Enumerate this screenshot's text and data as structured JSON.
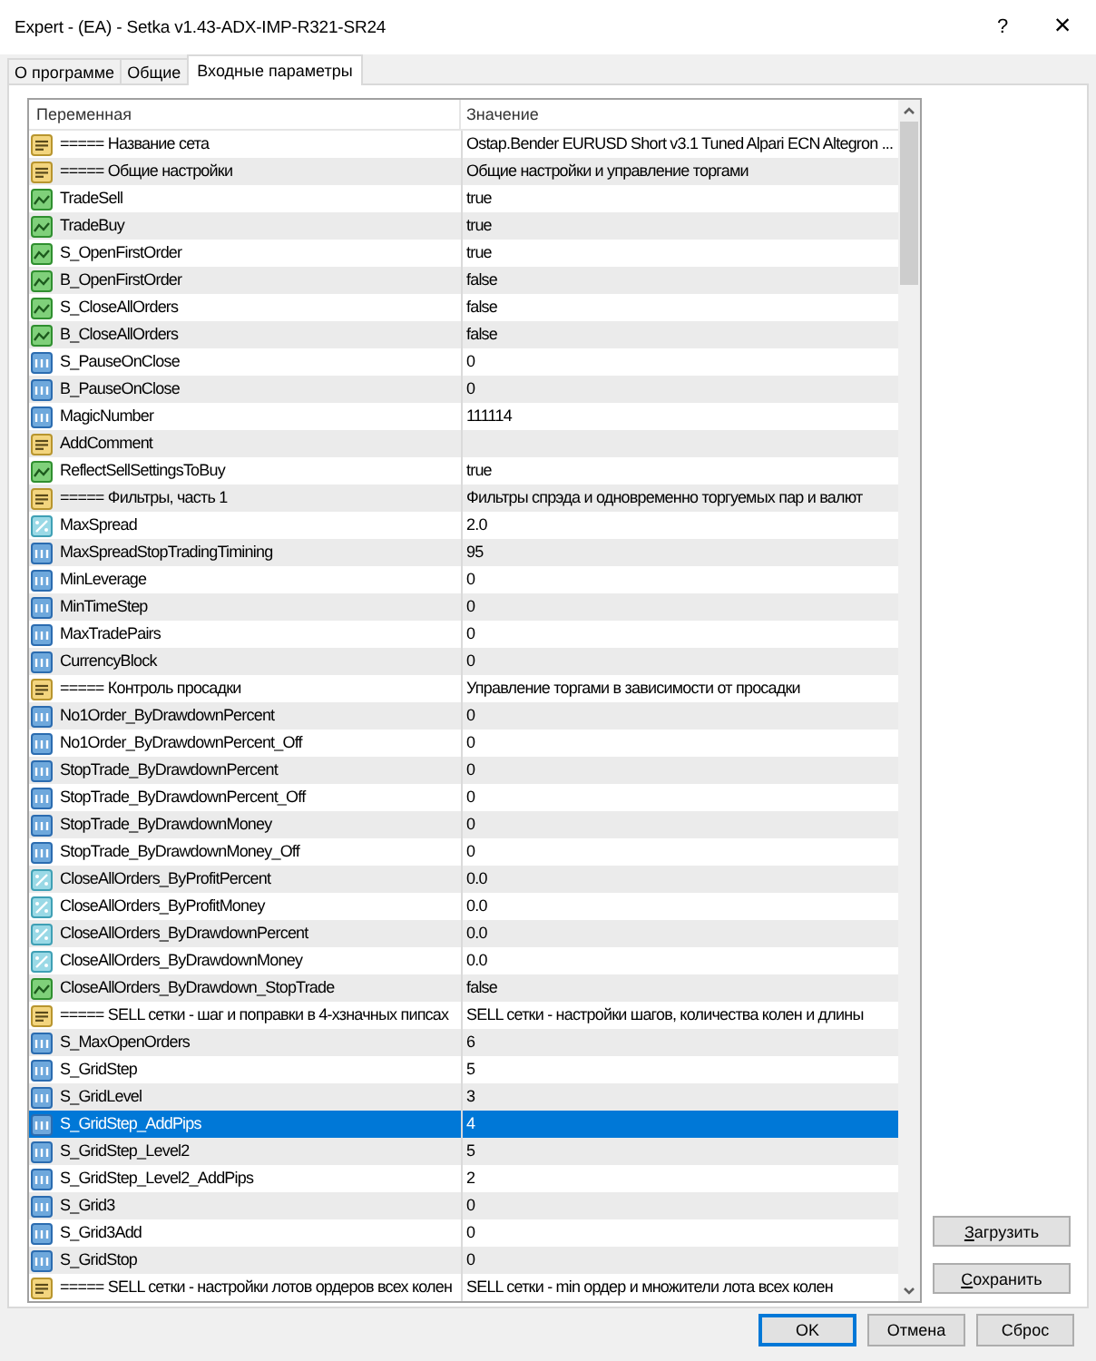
{
  "window": {
    "title": "Expert - (EA) - Setka v1.43-ADX-IMP-R321-SR24",
    "help_button": "?",
    "close_button": "×"
  },
  "tabs": [
    {
      "label": "О программе",
      "selected": false
    },
    {
      "label": "Общие",
      "selected": false
    },
    {
      "label": "Входные параметры",
      "selected": true
    }
  ],
  "table": {
    "columns": [
      "Переменная",
      "Значение"
    ],
    "rows": [
      {
        "kind": "string",
        "name": "===== Название сета",
        "value": "Ostap.Bender EURUSD Short v3.1 Tuned Alpari ECN Altegron ...",
        "selected": false
      },
      {
        "kind": "string",
        "name": "===== Общие настройки",
        "value": "Общие настройки и управление торгами",
        "selected": false
      },
      {
        "kind": "bool",
        "name": "TradeSell",
        "value": "true",
        "selected": false
      },
      {
        "kind": "bool",
        "name": "TradeBuy",
        "value": "true",
        "selected": false
      },
      {
        "kind": "bool",
        "name": "S_OpenFirstOrder",
        "value": "true",
        "selected": false
      },
      {
        "kind": "bool",
        "name": "B_OpenFirstOrder",
        "value": "false",
        "selected": false
      },
      {
        "kind": "bool",
        "name": "S_CloseAllOrders",
        "value": "false",
        "selected": false
      },
      {
        "kind": "bool",
        "name": "B_CloseAllOrders",
        "value": "false",
        "selected": false
      },
      {
        "kind": "int",
        "name": "S_PauseOnClose",
        "value": "0",
        "selected": false
      },
      {
        "kind": "int",
        "name": "B_PauseOnClose",
        "value": "0",
        "selected": false
      },
      {
        "kind": "int",
        "name": "MagicNumber",
        "value": "111114",
        "selected": false
      },
      {
        "kind": "string",
        "name": "AddComment",
        "selected": false
      },
      {
        "kind": "bool",
        "name": "ReflectSellSettingsToBuy",
        "value": "true",
        "selected": false
      },
      {
        "kind": "string",
        "name": "===== Фильтры, часть 1",
        "value": "Фильтры спрэда и одновременно торгуемых пар и валют",
        "selected": false
      },
      {
        "kind": "double",
        "name": "MaxSpread",
        "value": "2.0",
        "selected": false
      },
      {
        "kind": "int",
        "name": "MaxSpreadStopTradingTimining",
        "value": "95",
        "selected": false
      },
      {
        "kind": "int",
        "name": "MinLeverage",
        "value": "0",
        "selected": false
      },
      {
        "kind": "int",
        "name": "MinTimeStep",
        "value": "0",
        "selected": false
      },
      {
        "kind": "int",
        "name": "MaxTradePairs",
        "value": "0",
        "selected": false
      },
      {
        "kind": "int",
        "name": "CurrencyBlock",
        "value": "0",
        "selected": false
      },
      {
        "kind": "string",
        "name": "===== Контроль просадки",
        "value": "Управление торгами в зависимости от просадки",
        "selected": false
      },
      {
        "kind": "int",
        "name": "No1Order_ByDrawdownPercent",
        "value": "0",
        "selected": false
      },
      {
        "kind": "int",
        "name": "No1Order_ByDrawdownPercent_Off",
        "value": "0",
        "selected": false
      },
      {
        "kind": "int",
        "name": "StopTrade_ByDrawdownPercent",
        "value": "0",
        "selected": false
      },
      {
        "kind": "int",
        "name": "StopTrade_ByDrawdownPercent_Off",
        "value": "0",
        "selected": false
      },
      {
        "kind": "int",
        "name": "StopTrade_ByDrawdownMoney",
        "value": "0",
        "selected": false
      },
      {
        "kind": "int",
        "name": "StopTrade_ByDrawdownMoney_Off",
        "value": "0",
        "selected": false
      },
      {
        "kind": "double",
        "name": "CloseAllOrders_ByProfitPercent",
        "value": "0.0",
        "selected": false
      },
      {
        "kind": "double",
        "name": "CloseAllOrders_ByProfitMoney",
        "value": "0.0",
        "selected": false
      },
      {
        "kind": "double",
        "name": "CloseAllOrders_ByDrawdownPercent",
        "value": "0.0",
        "selected": false
      },
      {
        "kind": "double",
        "name": "CloseAllOrders_ByDrawdownMoney",
        "value": "0.0",
        "selected": false
      },
      {
        "kind": "bool",
        "name": "CloseAllOrders_ByDrawdown_StopTrade",
        "value": "false",
        "selected": false
      },
      {
        "kind": "string",
        "name": "===== SELL сетки - шаг и поправки в 4-хзначных пипсах",
        "value": "SELL сетки - настройки шагов, количества колен и длины",
        "selected": false
      },
      {
        "kind": "int",
        "name": "S_MaxOpenOrders",
        "value": "6",
        "selected": false
      },
      {
        "kind": "int",
        "name": "S_GridStep",
        "value": "5",
        "selected": false
      },
      {
        "kind": "int",
        "name": "S_GridLevel",
        "value": "3",
        "selected": false
      },
      {
        "kind": "int",
        "name": "S_GridStep_AddPips",
        "value": "4",
        "selected": true
      },
      {
        "kind": "int",
        "name": "S_GridStep_Level2",
        "value": "5",
        "selected": false
      },
      {
        "kind": "int",
        "name": "S_GridStep_Level2_AddPips",
        "value": "2",
        "selected": false
      },
      {
        "kind": "int",
        "name": "S_Grid3",
        "value": "0",
        "selected": false
      },
      {
        "kind": "int",
        "name": "S_Grid3Add",
        "value": "0",
        "selected": false
      },
      {
        "kind": "int",
        "name": "S_GridStop",
        "value": "0",
        "selected": false
      },
      {
        "kind": "string",
        "name": "===== SELL сетки - настройки лотов ордеров всех колен",
        "value": "SELL сетки - min ордер и множители лота всех колен",
        "selected": false
      }
    ]
  },
  "side_buttons": [
    "Загрузить",
    "Сохранить"
  ],
  "dialog_buttons": [
    {
      "label": "OK",
      "default": true
    },
    {
      "label": "Отмена",
      "default": false
    },
    {
      "label": "Сброс",
      "default": false
    }
  ]
}
